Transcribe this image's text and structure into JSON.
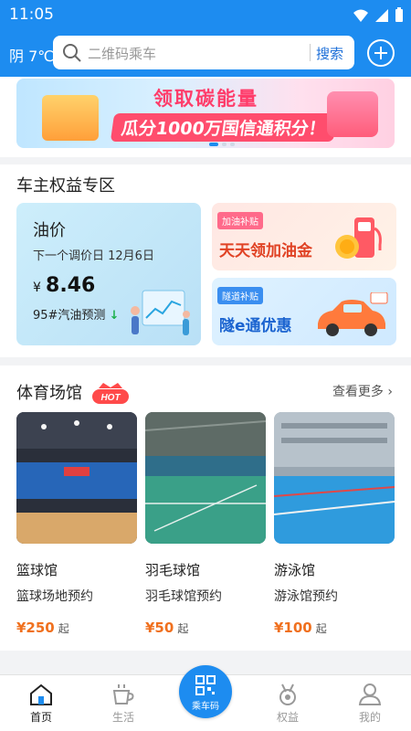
{
  "status_bar": {
    "time": "11:05"
  },
  "header": {
    "weather": "阴 7℃",
    "search_placeholder": "二维码乘车",
    "search_button": "搜索"
  },
  "banner": {
    "headline": "领取碳能量",
    "subline": "瓜分1000万国信通积分！"
  },
  "rights": {
    "title": "车主权益专区",
    "oil": {
      "title": "油价",
      "next_adjust": "下一个调价日 12月6日",
      "currency": "¥",
      "price": "8.46",
      "forecast": "95#汽油预测"
    },
    "promos": [
      {
        "tag": "加油补贴",
        "text": "天天领加油金"
      },
      {
        "tag": "隧道补贴",
        "text": "隧e通优惠"
      }
    ]
  },
  "venues": {
    "title": "体育场馆",
    "hot_badge": "HOT",
    "more": "查看更多",
    "items": [
      {
        "name": "篮球馆",
        "desc": "篮球场地预约",
        "price": "¥250",
        "unit": "起"
      },
      {
        "name": "羽毛球馆",
        "desc": "羽毛球馆预约",
        "price": "¥50",
        "unit": "起"
      },
      {
        "name": "游泳馆",
        "desc": "游泳馆预约",
        "price": "¥100",
        "unit": "起"
      }
    ]
  },
  "tabbar": {
    "home": "首页",
    "life": "生活",
    "ride": "乘车码",
    "benefits": "权益",
    "mine": "我的"
  },
  "colors": {
    "primary": "#1d8cf0",
    "price": "#f0701e"
  }
}
